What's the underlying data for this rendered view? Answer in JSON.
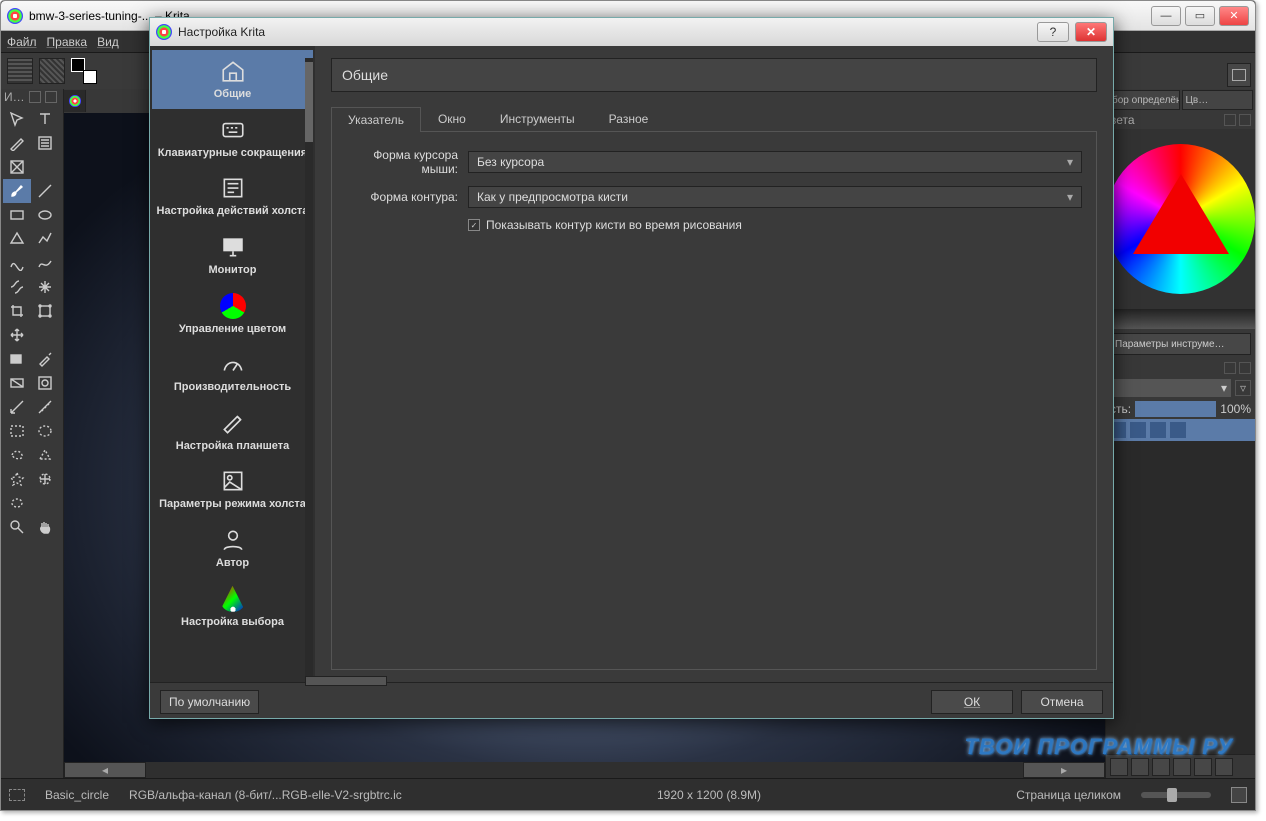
{
  "app": {
    "title": "bmw-3-series-tuning-... – Krita",
    "menu": [
      "Файл",
      "Правка",
      "Вид"
    ],
    "statusbar": {
      "brush": "Basic_circle",
      "colorspace": "RGB/альфа-канал (8-бит/...RGB-elle-V2-srgbtrc.ic",
      "dims": "1920 x 1200 (8.9M)",
      "zoom_label": "Страница целиком"
    },
    "window_buttons": {
      "min": "—",
      "max": "▭",
      "close": "✕"
    }
  },
  "right": {
    "tabs": [
      "бор определён…",
      "Цв…"
    ],
    "wheel_header": "вета",
    "tool_opts_btn": "Параметры инструме…",
    "opacity_label": "сть:",
    "opacity_value": "100%"
  },
  "dialog": {
    "title": "Настройка Krita",
    "categories": [
      "Общие",
      "Клавиатурные сокращения",
      "Настройка действий холста",
      "Монитор",
      "Управление цветом",
      "Производительность",
      "Настройка планшета",
      "Параметры режима холста",
      "Автор",
      "Настройка выбора"
    ],
    "section": "Общие",
    "tabs": [
      "Указатель",
      "Окно",
      "Инструменты",
      "Разное"
    ],
    "cursor_shape_label": "Форма курсора мыши:",
    "cursor_shape_value": "Без курсора",
    "outline_shape_label": "Форма контура:",
    "outline_shape_value": "Как у предпросмотра кисти",
    "show_outline_label": "Показывать контур кисти во время рисования",
    "buttons": {
      "defaults": "По умолчанию",
      "ok": "ОК",
      "cancel": "Отмена"
    },
    "title_buttons": {
      "help": "?",
      "close": "✕"
    }
  },
  "docker_head_label": "И…",
  "watermark": "ТВОИ ПРОГРАММЫ РУ"
}
